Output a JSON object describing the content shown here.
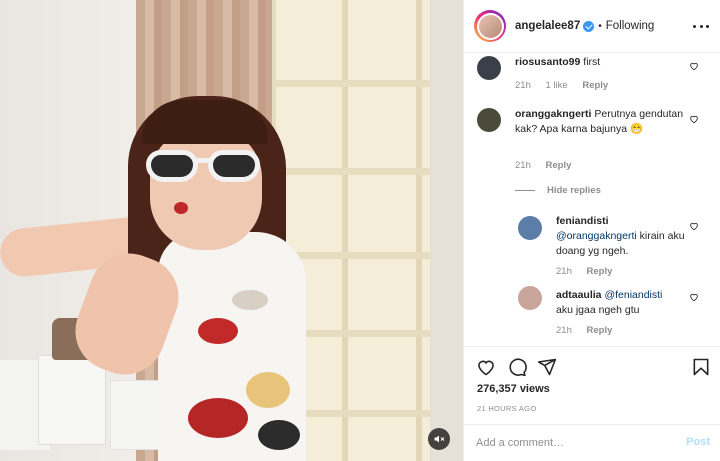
{
  "post": {
    "username": "angelalee87",
    "follow_status": "Following",
    "separator": "•",
    "views": "276,357 views",
    "time_ago": "21 HOURS AGO"
  },
  "comments": [
    {
      "username": "riosusanto99",
      "text": "first",
      "time": "21h",
      "likes": "1 like",
      "reply": "Reply",
      "avatar_color": "#3a3f4a"
    },
    {
      "username": "oranggakngerti",
      "text": "Perutnya gendutan kak? Apa karna bajunya 😁",
      "time": "21h",
      "reply": "Reply",
      "avatar_color": "#4c4a3a"
    }
  ],
  "hide_replies": "Hide replies",
  "replies": [
    {
      "username": "feniandisti",
      "mention": "@oranggakngerti",
      "text": "kirain aku doang yg ngeh.",
      "time": "21h",
      "reply": "Reply",
      "avatar_color": "#5b7da8"
    },
    {
      "username": "adtaaulia",
      "mention": "@feniandisti",
      "text": "aku jgaa ngeh gtu",
      "time": "21h",
      "reply": "Reply",
      "avatar_color": "#c9a49a"
    }
  ],
  "add_comment": {
    "placeholder": "Add a comment…",
    "post_label": "Post"
  },
  "icons": [
    "heart-icon",
    "comment-icon",
    "share-icon",
    "bookmark-icon",
    "more-icon",
    "mute-icon",
    "verified-badge-icon"
  ],
  "colors": {
    "verified": "#3897f0",
    "post_disabled": "#b2dffc",
    "mention": "#00376b",
    "meta": "#8e8e8e"
  }
}
